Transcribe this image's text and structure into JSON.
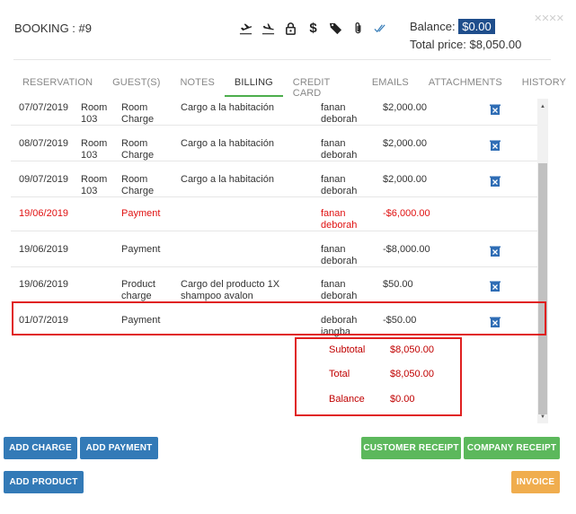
{
  "header": {
    "title": "BOOKING : #9",
    "balance_label": "Balance:",
    "balance_value": "$0.00",
    "total_price": "Total price: $8,050.00",
    "close_glyph": "✕✕✕✕"
  },
  "toolbar": {
    "icons": [
      "plane-departure-icon",
      "plane-arrival-icon",
      "lock-icon",
      "dollar-icon",
      "tag-icon",
      "paperclip-icon",
      "double-check-icon"
    ],
    "dollar_glyph": "$",
    "check_color": "#337ab7"
  },
  "tabs": [
    {
      "label": "RESERVATION"
    },
    {
      "label": "GUEST(S)"
    },
    {
      "label": "NOTES"
    },
    {
      "label": "BILLING"
    },
    {
      "label": "CREDIT CARD"
    },
    {
      "label": "EMAILS"
    },
    {
      "label": "ATTACHMENTS"
    },
    {
      "label": "HISTORY"
    }
  ],
  "rows": [
    {
      "date": "07/07/2019",
      "room": "Room 103",
      "concept": "Room Charge",
      "desc": "Cargo a la habitación",
      "user": "fanan deborah",
      "amount": "$2,000.00",
      "red": false,
      "deletable": true
    },
    {
      "date": "08/07/2019",
      "room": "Room 103",
      "concept": "Room Charge",
      "desc": "Cargo a la habitación",
      "user": "fanan deborah",
      "amount": "$2,000.00",
      "red": false,
      "deletable": true
    },
    {
      "date": "09/07/2019",
      "room": "Room 103",
      "concept": "Room Charge",
      "desc": "Cargo a la habitación",
      "user": "fanan deborah",
      "amount": "$2,000.00",
      "red": false,
      "deletable": true
    },
    {
      "date": "19/06/2019",
      "room": "",
      "concept": "Payment",
      "desc": "",
      "user": "fanan deborah",
      "amount": "-$6,000.00",
      "red": true,
      "deletable": false
    },
    {
      "date": "19/06/2019",
      "room": "",
      "concept": "Payment",
      "desc": "",
      "user": "fanan deborah",
      "amount": "-$8,000.00",
      "red": false,
      "deletable": true
    },
    {
      "date": "19/06/2019",
      "room": "",
      "concept": "Product charge",
      "desc": "Cargo del producto 1X shampoo avalon",
      "user": "fanan deborah",
      "amount": "$50.00",
      "red": false,
      "deletable": true
    },
    {
      "date": "01/07/2019",
      "room": "",
      "concept": "Payment",
      "desc": "",
      "user": "deborah iangba",
      "amount": "-$50.00",
      "red": false,
      "deletable": true
    }
  ],
  "totals": {
    "subtotal_label": "Subtotal",
    "subtotal": "$8,050.00",
    "total_label": "Total",
    "total": "$8,050.00",
    "balance_label": "Balance",
    "balance": "$0.00"
  },
  "buttons": {
    "add_charge": "ADD CHARGE",
    "add_payment": "ADD PAYMENT",
    "add_product": "ADD PRODUCT",
    "customer_receipt": "CUSTOMER RECEIPT",
    "company_receipt": "COMPANY RECEIPT",
    "invoice": "INVOICE"
  },
  "colors": {
    "accent_blue": "#337ab7",
    "green": "#5cb85c",
    "orange": "#f0ad4e",
    "red": "#e01111",
    "badge": "#1f4e8c",
    "delete_icon": "#2f6db5"
  }
}
